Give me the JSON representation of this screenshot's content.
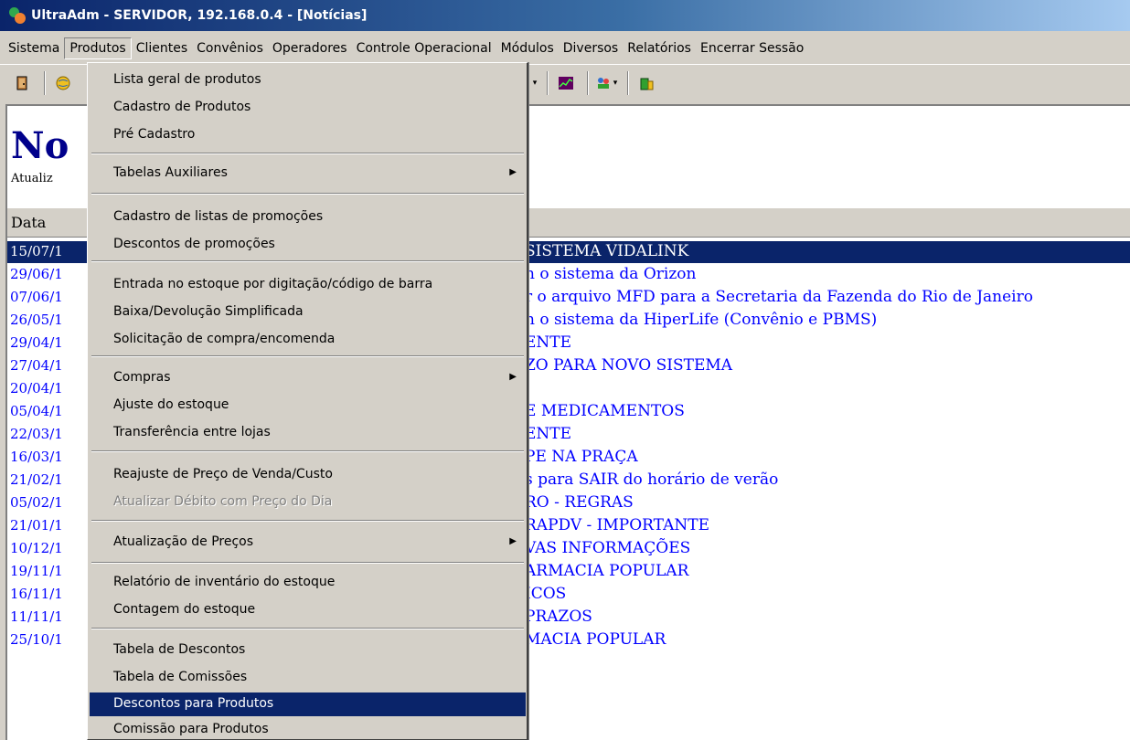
{
  "window": {
    "title": "UltraAdm - SERVIDOR, 192.168.0.4 - [Notícias]"
  },
  "menubar": {
    "items": [
      "Sistema",
      "Produtos",
      "Clientes",
      "Convênios",
      "Operadores",
      "Controle Operacional",
      "Módulos",
      "Diversos",
      "Relatórios",
      "Encerrar Sessão"
    ],
    "open_item": "Produtos"
  },
  "toolbar": {
    "icons": [
      "exit-door-icon",
      "globe-icon",
      "book-icon",
      "pie-chart-icon",
      "line-chart-icon",
      "people-icon",
      "building-icon"
    ]
  },
  "content": {
    "title": "No",
    "subtitle": "Atualiz",
    "column_header": "Data",
    "news": [
      {
        "date": "15/07/1",
        "title": "SISTEMA VIDALINK",
        "selected": true
      },
      {
        "date": "29/06/1",
        "title": "n o sistema da Orizon"
      },
      {
        "date": "07/06/1",
        "title": "r o arquivo MFD para a Secretaria da Fazenda do Rio de Janeiro"
      },
      {
        "date": "26/05/1",
        "title": "n o sistema da HiperLife (Convênio e PBMS)"
      },
      {
        "date": "29/04/1",
        "title": "ENTE"
      },
      {
        "date": "27/04/1",
        "title": "ZO PARA NOVO SISTEMA"
      },
      {
        "date": "20/04/1",
        "title": ""
      },
      {
        "date": "05/04/1",
        "title": "E MEDICAMENTOS"
      },
      {
        "date": "22/03/1",
        "title": "ENTE"
      },
      {
        "date": "16/03/1",
        "title": "PE NA PRAÇA"
      },
      {
        "date": "21/02/1",
        "title": "s para SAIR do horário de verão"
      },
      {
        "date": "05/02/1",
        "title": "RO - REGRAS"
      },
      {
        "date": "21/01/1",
        "title": "RAPDV - IMPORTANTE"
      },
      {
        "date": "10/12/1",
        "title": "VAS INFORMAÇÕES"
      },
      {
        "date": "19/11/1",
        "title": "ARMACIA POPULAR"
      },
      {
        "date": "16/11/1",
        "title": "ICOS"
      },
      {
        "date": "11/11/1",
        "title": "PRAZOS"
      },
      {
        "date": "25/10/1",
        "title": "MACIA POPULAR"
      }
    ]
  },
  "dropdown": {
    "items": [
      {
        "label": "Lista geral de produtos"
      },
      {
        "label": "Cadastro de Produtos"
      },
      {
        "label": "Pré Cadastro"
      },
      {
        "label": "Tabelas Auxiliares",
        "submenu": true
      },
      {
        "label": "Cadastro de listas de promoções"
      },
      {
        "label": "Descontos de promoções"
      },
      {
        "label": "Entrada no estoque por digitação/código de barra"
      },
      {
        "label": "Baixa/Devolução Simplificada"
      },
      {
        "label": "Solicitação de compra/encomenda"
      },
      {
        "label": "Compras",
        "submenu": true
      },
      {
        "label": "Ajuste do estoque"
      },
      {
        "label": "Transferência entre lojas"
      },
      {
        "label": "Reajuste de Preço de Venda/Custo"
      },
      {
        "label": "Atualizar Débito com Preço do Dia",
        "disabled": true
      },
      {
        "label": "Atualização de Preços",
        "submenu": true
      },
      {
        "label": "Relatório de inventário do estoque"
      },
      {
        "label": "Contagem do estoque"
      },
      {
        "label": "Tabela de Descontos"
      },
      {
        "label": "Tabela de Comissões"
      },
      {
        "label": "Descontos para Produtos",
        "highlighted": true
      },
      {
        "label": "Comissão para Produtos"
      }
    ],
    "submenu_arrow": "▶"
  },
  "colors": {
    "titlebar": "#0a246a",
    "menu_bg": "#d4d0c8",
    "highlight": "#0a246a",
    "link": "#0000ff",
    "page_title": "#00008b"
  }
}
